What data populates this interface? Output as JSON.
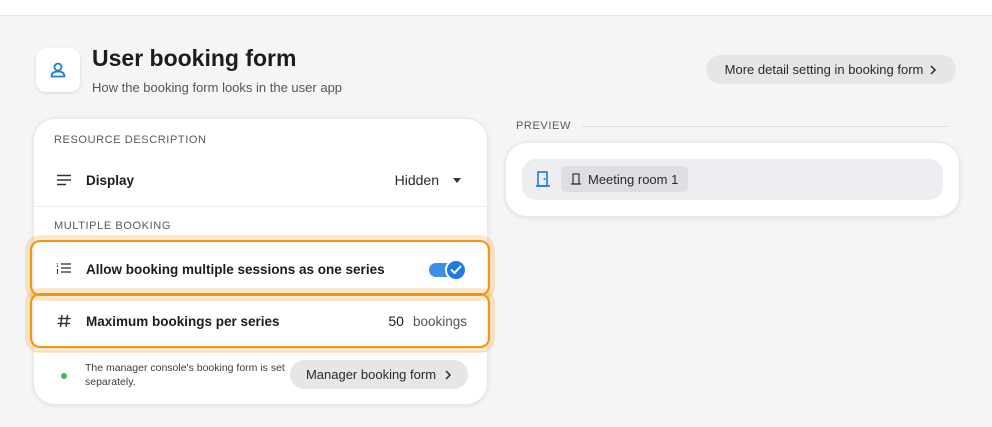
{
  "header": {
    "title": "User booking form",
    "subtitle": "How the booking form looks in the user app",
    "icon": "user-icon",
    "detail_button_label": "More detail setting in booking form"
  },
  "resource_description": {
    "section_label": "RESOURCE DESCRIPTION",
    "display": {
      "icon": "lines-icon",
      "label": "Display",
      "value": "Hidden"
    }
  },
  "multiple_booking": {
    "section_label": "MULTIPLE BOOKING",
    "allow_series": {
      "icon": "numbered-list-icon",
      "label": "Allow booking multiple sessions as one series",
      "enabled": true
    },
    "max_bookings": {
      "icon": "hash-icon",
      "label": "Maximum bookings per series",
      "value": "50",
      "unit": "bookings"
    }
  },
  "note": {
    "text": "The manager console's booking form is set separately.",
    "button_label": "Manager booking form"
  },
  "preview": {
    "label": "PREVIEW",
    "room_chip": "Meeting room 1"
  },
  "colors": {
    "accent": "#1e7be0",
    "highlight": "#f0960f",
    "status": "#2dbe5b"
  }
}
